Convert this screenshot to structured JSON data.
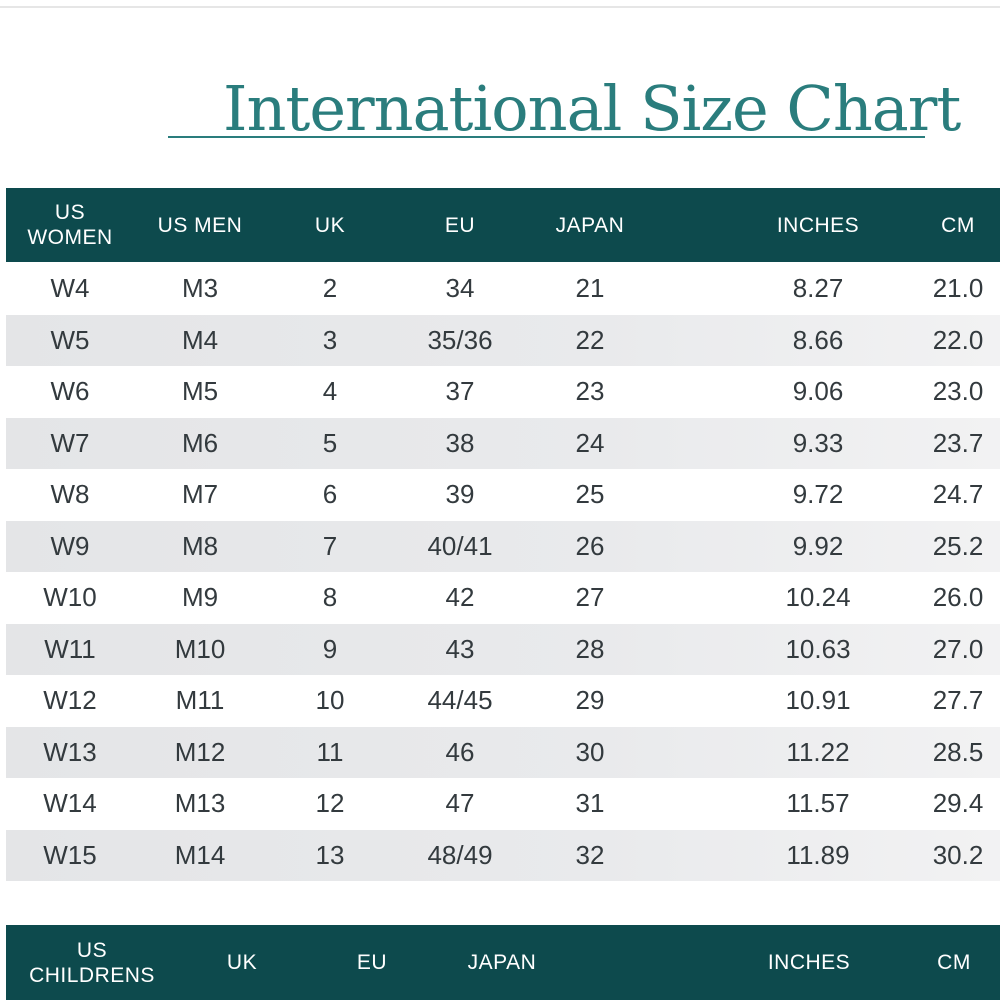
{
  "title": "International Size Chart",
  "colors": {
    "header_bg": "#0d4a4d",
    "title": "#2a7d7d",
    "row_shade": "#e6e7e9"
  },
  "adult_table": {
    "columns": [
      "US\nWOMEN",
      "US MEN",
      "UK",
      "EU",
      "JAPAN",
      "INCHES",
      "CM"
    ],
    "rows": [
      [
        "W4",
        "M3",
        "2",
        "34",
        "21",
        "8.27",
        "21.0"
      ],
      [
        "W5",
        "M4",
        "3",
        "35/36",
        "22",
        "8.66",
        "22.0"
      ],
      [
        "W6",
        "M5",
        "4",
        "37",
        "23",
        "9.06",
        "23.0"
      ],
      [
        "W7",
        "M6",
        "5",
        "38",
        "24",
        "9.33",
        "23.7"
      ],
      [
        "W8",
        "M7",
        "6",
        "39",
        "25",
        "9.72",
        "24.7"
      ],
      [
        "W9",
        "M8",
        "7",
        "40/41",
        "26",
        "9.92",
        "25.2"
      ],
      [
        "W10",
        "M9",
        "8",
        "42",
        "27",
        "10.24",
        "26.0"
      ],
      [
        "W11",
        "M10",
        "9",
        "43",
        "28",
        "10.63",
        "27.0"
      ],
      [
        "W12",
        "M11",
        "10",
        "44/45",
        "29",
        "10.91",
        "27.7"
      ],
      [
        "W13",
        "M12",
        "11",
        "46",
        "30",
        "11.22",
        "28.5"
      ],
      [
        "W14",
        "M13",
        "12",
        "47",
        "31",
        "11.57",
        "29.4"
      ],
      [
        "W15",
        "M14",
        "13",
        "48/49",
        "32",
        "11.89",
        "30.2"
      ]
    ]
  },
  "childrens_table": {
    "columns": [
      "US\nCHILDRENS",
      "UK",
      "EU",
      "JAPAN",
      "INCHES",
      "CM"
    ]
  }
}
